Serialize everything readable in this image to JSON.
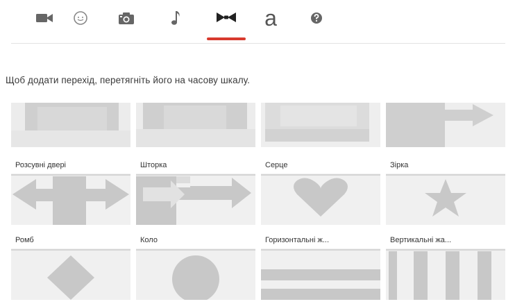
{
  "tabs": [
    {
      "name": "video-camera-icon",
      "label": ""
    },
    {
      "name": "emoji-icon",
      "label": ""
    },
    {
      "name": "camera-icon",
      "label": ""
    },
    {
      "name": "music-note-icon",
      "label": ""
    },
    {
      "name": "transitions-bowtie-icon",
      "label": "",
      "active": true
    },
    {
      "name": "text-icon",
      "label": "a"
    },
    {
      "name": "help-icon",
      "label": ""
    }
  ],
  "accent_color": "#d83a2e",
  "instruction": "Щоб додати перехід, перетягніть його на часову шкалу.",
  "transitions": [
    {
      "label": "Розсувні двері",
      "icon": "sliding-doors-preview"
    },
    {
      "label": "Шторка",
      "icon": "wipe-preview"
    },
    {
      "label": "Серце",
      "icon": "heart-preview"
    },
    {
      "label": "Зірка",
      "icon": "star-preview"
    },
    {
      "label": "Ромб",
      "icon": "diamond-preview"
    },
    {
      "label": "Коло",
      "icon": "circle-preview"
    },
    {
      "label": "Горизонтальні ж...",
      "icon": "horizontal-blinds-preview"
    },
    {
      "label": "Вертикальні жа...",
      "icon": "vertical-blinds-preview"
    }
  ]
}
